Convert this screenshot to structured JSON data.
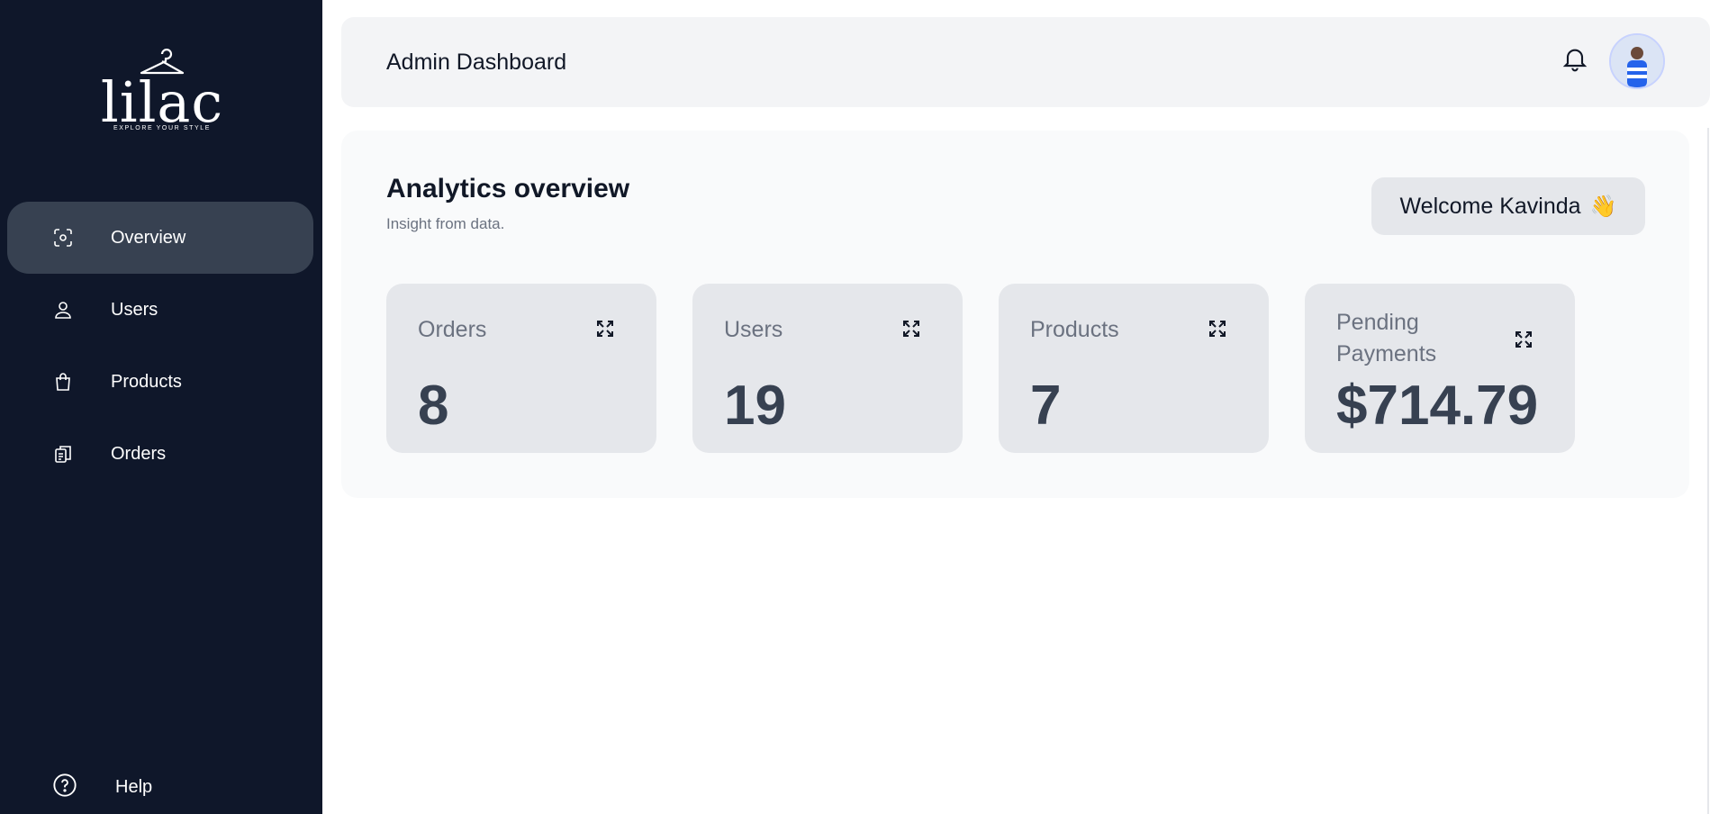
{
  "sidebar": {
    "logo": {
      "word": "lilac",
      "tagline": "EXPLORE YOUR STYLE"
    },
    "items": [
      {
        "label": "Overview",
        "icon": "overview-icon",
        "active": true
      },
      {
        "label": "Users",
        "icon": "user-icon",
        "active": false
      },
      {
        "label": "Products",
        "icon": "shopping-bag-icon",
        "active": false
      },
      {
        "label": "Orders",
        "icon": "orders-icon",
        "active": false
      }
    ],
    "help": {
      "label": "Help",
      "icon": "help-icon"
    }
  },
  "header": {
    "title": "Admin Dashboard",
    "bell_icon": "bell-icon",
    "avatar": "user-avatar"
  },
  "main": {
    "heading": "Analytics overview",
    "subheading": "Insight from data.",
    "welcome": {
      "text": "Welcome Kavinda",
      "emoji": "👋"
    },
    "cards": [
      {
        "title": "Orders",
        "value": "8"
      },
      {
        "title": "Users",
        "value": "19"
      },
      {
        "title": "Products",
        "value": "7"
      },
      {
        "title": "Pending Payments",
        "value": "$714.79"
      }
    ]
  },
  "colors": {
    "sidebar_bg": "#0f172a",
    "active_item_bg": "#374151",
    "card_bg": "#e5e7eb",
    "value_text": "#374151"
  }
}
